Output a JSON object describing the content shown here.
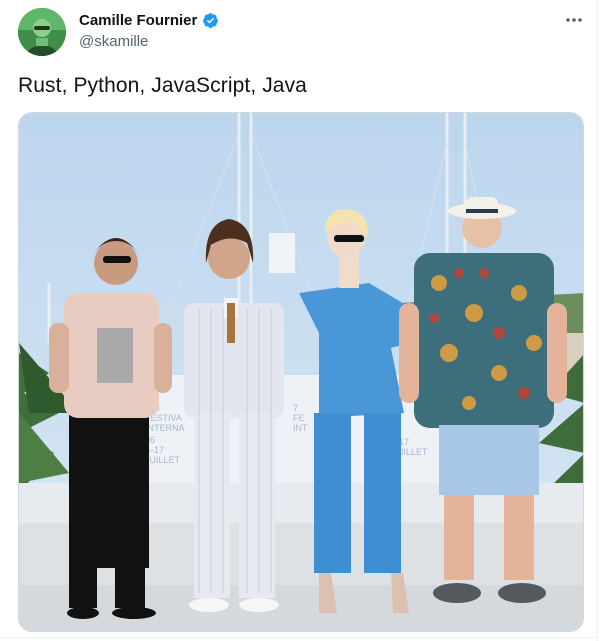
{
  "tweet": {
    "author": {
      "display_name": "Camille Fournier",
      "handle": "@skamille",
      "verified": true,
      "avatar_icon": "avatar-photo"
    },
    "text": "Rust, Python, JavaScript, Java",
    "more_icon": "more-horizontal-icon",
    "media": {
      "type": "photo",
      "backdrop_text_left": [
        "74e",
        "FESTIVA",
        "INTERNA",
        "06",
        "—17",
        "JUILLET"
      ],
      "backdrop_text_mid": [
        "7",
        "FE",
        "INT"
      ],
      "backdrop_text_right": [
        "17",
        "JILLET"
      ]
    }
  },
  "colors": {
    "verified_badge": "#1d9bf0",
    "text_primary": "#0f1419",
    "text_secondary": "#536471",
    "border": "#cfd9de"
  }
}
